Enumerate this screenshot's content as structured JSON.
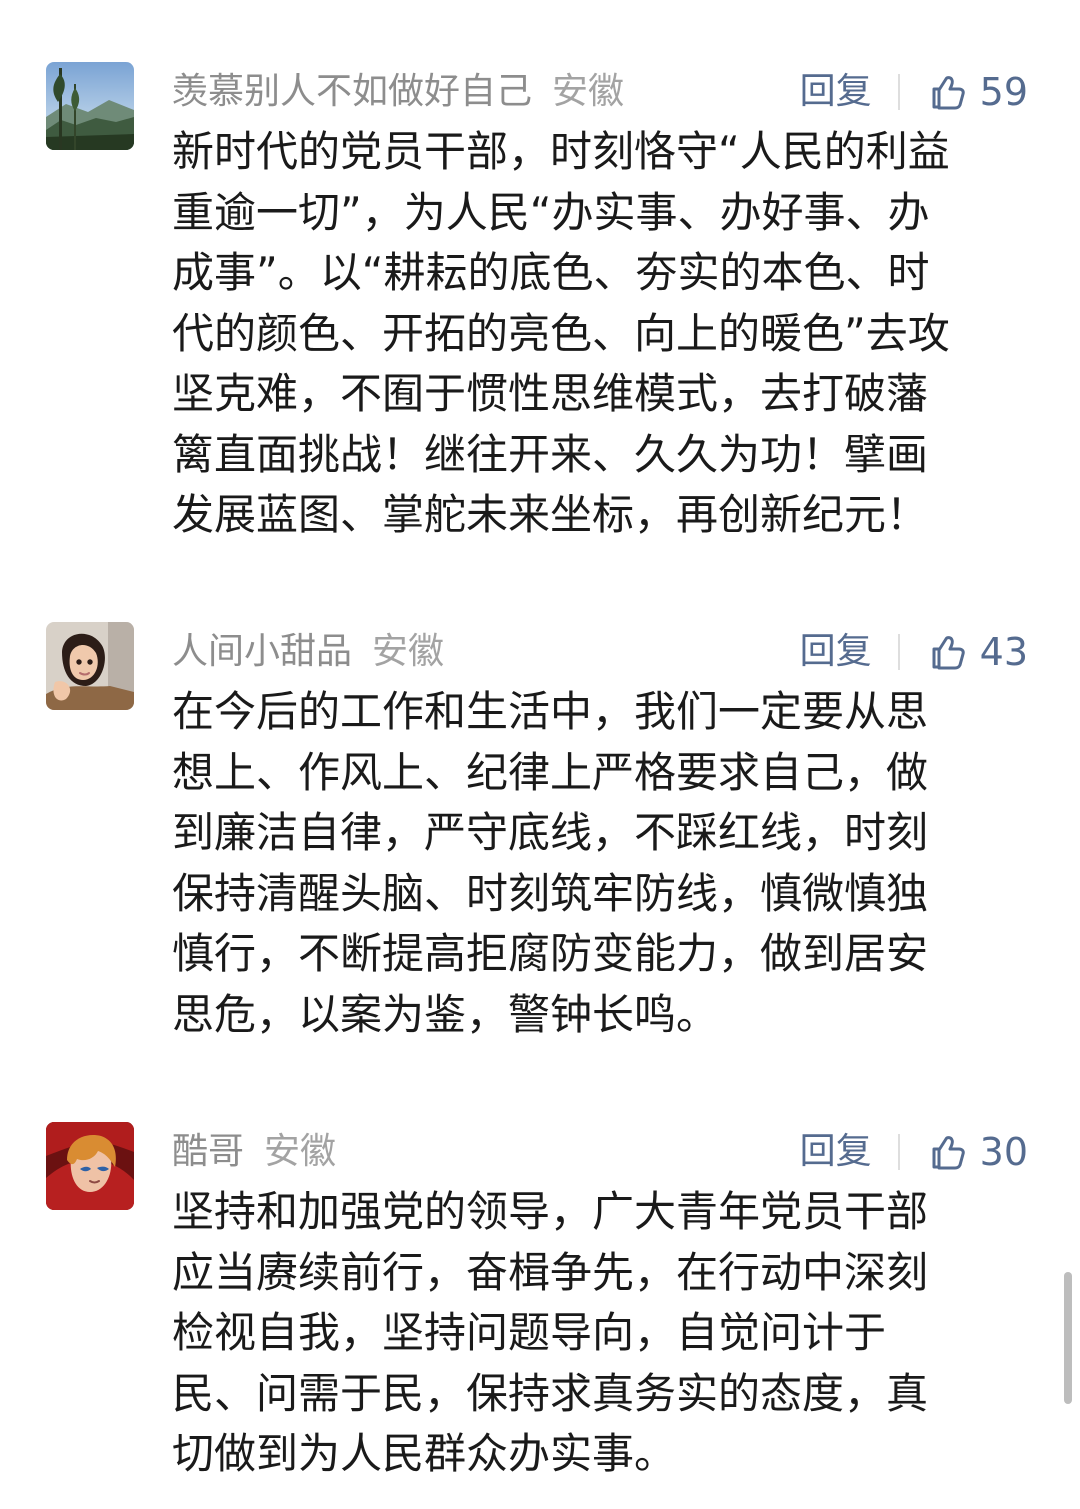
{
  "comments": [
    {
      "user": "羡慕别人不如做好自己",
      "location": "安徽",
      "reply_label": "回复",
      "likes": "59",
      "avatar_icon": "landscape-avatar",
      "lines": [
        "新时代的党员干部，时刻恪守“人民的利益",
        "重逾一切”，为人民“办实事、办好事、办",
        "成事”。以“耕耘的底色、夯实的本色、时",
        "代的颜色、开拓的亮色、向上的暖色”去攻",
        "坚克难，不囿于惯性思维模式，去打破藩",
        "篱直面挑战！继往开来、久久为功！擘画",
        "发展蓝图、掌舵未来坐标，再创新纪元！"
      ]
    },
    {
      "user": "人间小甜品",
      "location": "安徽",
      "reply_label": "回复",
      "likes": "43",
      "avatar_icon": "child-avatar",
      "lines": [
        "在今后的工作和生活中，我们一定要从思",
        "想上、作风上、纪律上严格要求自己，做",
        "到廉洁自律，严守底线，不踩红线，时刻",
        "保持清醒头脑、时刻筑牢防线，慎微慎独",
        "慎行，不断提高拒腐防变能力，做到居安",
        "思危，以案为鉴，警钟长鸣。"
      ]
    },
    {
      "user": "酷哥",
      "location": "安徽",
      "reply_label": "回复",
      "likes": "30",
      "avatar_icon": "anime-avatar",
      "lines": [
        "坚持和加强党的领导，广大青年党员干部",
        "应当赓续前行，奋楫争先，在行动中深刻",
        "检视自我，坚持问题导向，自觉问计于",
        "民、问需于民，保持求真务实的态度，真",
        "切做到为人民群众办实事。"
      ]
    }
  ],
  "colors": {
    "name": "#8d8d8d",
    "accent": "#556b8f",
    "text": "#1a1a1a"
  },
  "icons": {
    "like": "thumbs-up-icon"
  }
}
